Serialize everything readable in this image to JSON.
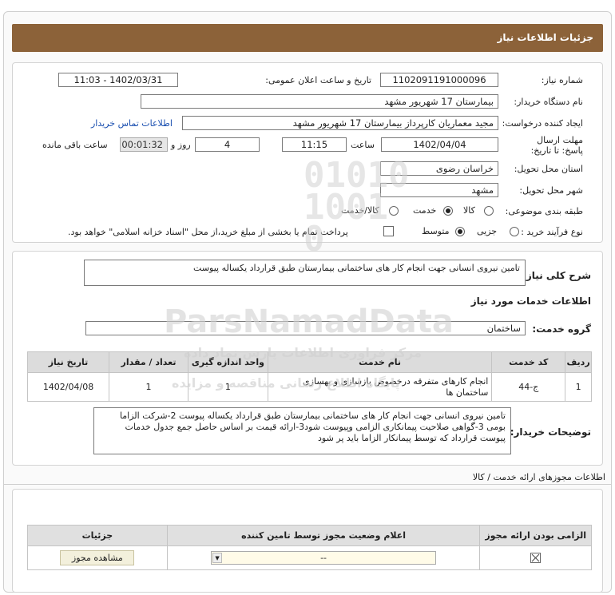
{
  "header": {
    "title": "جزئیات اطلاعات نیاز"
  },
  "form": {
    "need_number_label": "شماره نیاز:",
    "need_number": "1102091191000096",
    "announce_label": "تاریخ و ساعت اعلان عمومی:",
    "announce_value": "1402/03/31 - 11:03",
    "buyer_org_label": "نام دستگاه خریدار:",
    "buyer_org": "بیمارستان 17 شهریور مشهد",
    "requester_label": "ایجاد کننده درخواست:",
    "requester": "مجید معماریان کارپرداز بیمارستان 17 شهریور مشهد",
    "contact_link": "اطلاعات تماس خریدار",
    "deadline_label": "مهلت ارسال پاسخ: تا تاریخ:",
    "deadline_date": "1402/04/04",
    "time_label": "ساعت",
    "deadline_time": "11:15",
    "days_value": "4",
    "days_label": "روز و",
    "remaining_time": "00:01:32",
    "remaining_label": "ساعت باقی مانده",
    "province_label": "استان محل تحویل:",
    "province": "خراسان رضوی",
    "city_label": "شهر محل تحویل:",
    "city": "مشهد",
    "category_label": "طبقه بندی موضوعی:",
    "category_options": [
      "کالا",
      "خدمت",
      "کالا/خدمت"
    ],
    "process_label": "نوع فرآیند خرید :",
    "process_options": [
      "جزیی",
      "متوسط"
    ],
    "payment_note": "پرداخت تمام یا بخشی از مبلغ خرید،از محل \"اسناد خزانه اسلامی\" خواهد بود."
  },
  "need": {
    "summary_label": "شرح کلی نیاز:",
    "summary": "تامین نیروی انسانی جهت انجام کار های ساختمانی بیمارستان طبق قرارداد یکساله پیوست",
    "services_title": "اطلاعات خدمات مورد نیاز",
    "service_group_label": "گروه خدمت:",
    "service_group": "ساختمان",
    "table": {
      "headers": [
        "ردیف",
        "کد خدمت",
        "نام خدمت",
        "واحد اندازه گیری",
        "تعداد / مقدار",
        "تاریخ نیاز"
      ],
      "rows": [
        [
          "1",
          "ج-44",
          "انجام کارهای متفرقه درخصوص بازسازی و بهسازی ساختمان ها",
          "1",
          "1",
          "1402/04/08"
        ]
      ]
    },
    "buyer_notes_label": "توضیحات خریدار:",
    "buyer_notes": "تامین نیروی انسانی جهت انجام کار های ساختمانی بیمارستان طبق قرارداد یکساله پیوست 2-شرکت الزاما بومی 3-گواهی صلاحیت پیمانکاری الزامی وپیوست شود3-ارائه قیمت بر اساس حاصل جمع جدول خدمات پیوست قرارداد که توسط پیمانکار الزاما باید پر شود"
  },
  "licenses": {
    "section_title": "اطلاعات مجوزهای ارائه خدمت / کالا",
    "headers": [
      "الزامی بودن ارائه مجوز",
      "اعلام وضعیت مجوز توسط تامین کننده",
      "جزئیات"
    ],
    "select_value": "--",
    "view_button": "مشاهده مجوز"
  },
  "watermark": {
    "line1": "ParsNamadData",
    "line2": "مرکز فراوری اطلاعات پارس نماد داده",
    "line3": "پایگاه اطلاع رسانی مناقصه و مزایده"
  }
}
